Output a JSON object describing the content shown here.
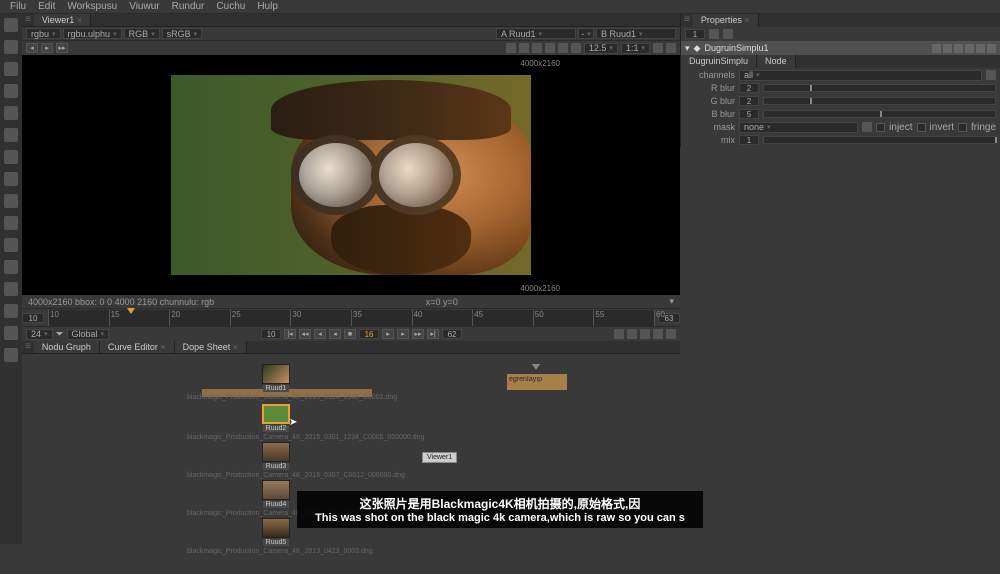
{
  "menu": [
    "Filu",
    "Edit",
    "Workspusu",
    "Viuwur",
    "Rundur",
    "Cuchu",
    "Hulp"
  ],
  "viewer": {
    "tab": "Viewer1",
    "channels": [
      "rgbu",
      "rgbu.ulphu",
      "RGB",
      "sRGB"
    ],
    "node_a": "A Ruud1",
    "node_b": "B Ruud1",
    "zoom": "12.5",
    "ratio": "1:1",
    "dim": "4000x2160",
    "status_left": "4000x2160  bbox: 0 0 4000 2160 chunnulu: rgb",
    "status_right": "x=0 y=0"
  },
  "timeline": {
    "start": "10",
    "end": "63",
    "current": "16",
    "ticks": [
      "10",
      "15",
      "20",
      "25",
      "30",
      "35",
      "40",
      "45",
      "50",
      "55",
      "60"
    ],
    "fps": "24",
    "mode": "Global",
    "frame_start_box": "10",
    "frame_end_box": "62"
  },
  "lower_tabs": [
    "Nodu Gruph",
    "Curve Editor",
    "Dope Sheet"
  ],
  "nodes": {
    "read_prefix": "Ruud",
    "backdrop": "egrenIayıp",
    "viewer": "Viewer1",
    "files": [
      "blackmagic_Production_Camera_4K_2015_0124_1948_C0002.dng",
      "blackmagic_Production_Camera_4K_2015_0301_1234_C0005_000000.dng",
      "blackmagic_Production_Camera_4K_2015_0307_C0012_000000.dng",
      "blackmagic_Production_Camera_4K_2013_0423_0003.dng",
      "blackmagic_Production_Camera_4K_2013_0423_0003.dng"
    ]
  },
  "properties": {
    "panel": "Properties",
    "node_name": "DugruinSimplu1",
    "tab1": "DugruinSimplu",
    "tab2": "Node",
    "rows": {
      "channels": {
        "label": "channels",
        "value": "all"
      },
      "rblur": {
        "label": "R blur",
        "value": "2"
      },
      "gblur": {
        "label": "G blur",
        "value": "2"
      },
      "bblur": {
        "label": "B blur",
        "value": "5"
      },
      "mask": {
        "label": "mask",
        "value": "none",
        "inject": "inject",
        "invert": "invert",
        "fringe": "fringe"
      },
      "mix": {
        "label": "mix",
        "value": "1"
      }
    }
  },
  "subtitles": {
    "cn": "这张照片是用Blackmagic4K相机拍摄的,原始格式,因",
    "en": "This was shot on the black magic 4k camera,which is raw so you can s"
  }
}
